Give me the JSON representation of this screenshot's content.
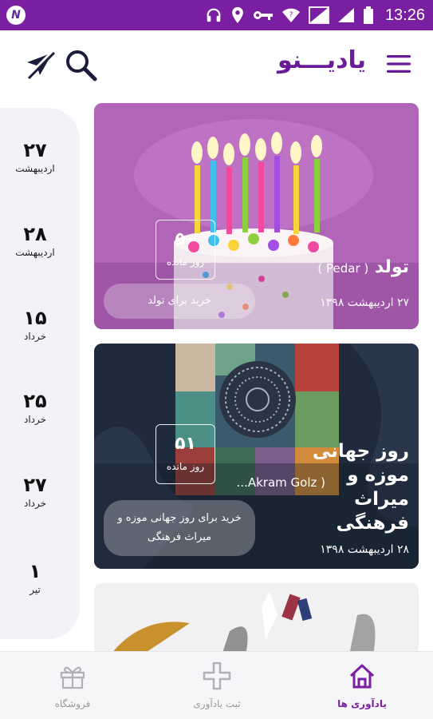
{
  "status_bar": {
    "time": "13:26",
    "app_badge": "N",
    "icons": [
      "headphones-icon",
      "location-icon",
      "key-icon",
      "wifi-icon",
      "signal-icon",
      "signal-icon",
      "battery-icon"
    ]
  },
  "app_bar": {
    "title": "یادیـــنو",
    "menu_icon": "hamburger-menu-icon",
    "search_icon": "search-icon",
    "plane_icon": "airplane-off-icon",
    "accent": "#6a1b9a"
  },
  "date_strip": {
    "items": [
      {
        "day": "۲۷",
        "month": "اردیبهشت"
      },
      {
        "day": "۲۸",
        "month": "اردیبهشت"
      },
      {
        "day": "۱۵",
        "month": "خرداد"
      },
      {
        "day": "۲۵",
        "month": "خرداد"
      },
      {
        "day": "۲۷",
        "month": "خرداد"
      },
      {
        "day": "۱",
        "month": "تیر"
      }
    ]
  },
  "cards": [
    {
      "title": "تولد",
      "subtitle": "( Pedar )",
      "date": "۲۷ اردیبهشت ۱۳۹۸",
      "days_left": "۵۰",
      "days_left_label": "روز مانده",
      "buy_label": "خرید برای تولد"
    },
    {
      "title_lines": [
        "روز جهانی",
        "موزه و",
        "میراث",
        "فرهنگی"
      ],
      "subtitle": "( Akram Golz...",
      "date": "۲۸ اردیبهشت ۱۳۹۸",
      "days_left": "۵۱",
      "days_left_label": "روز مانده",
      "buy_label": "خرید برای روز جهانی موزه و میراث فرهنگی"
    }
  ],
  "bottom_nav": {
    "items": [
      {
        "label": "یادآوری ها",
        "icon": "home-icon",
        "active": true
      },
      {
        "label": "ثبت یادآوری",
        "icon": "plus-icon",
        "active": false
      },
      {
        "label": "فروشگاه",
        "icon": "gift-icon",
        "active": false
      }
    ],
    "active_color": "#7b1fa2"
  }
}
